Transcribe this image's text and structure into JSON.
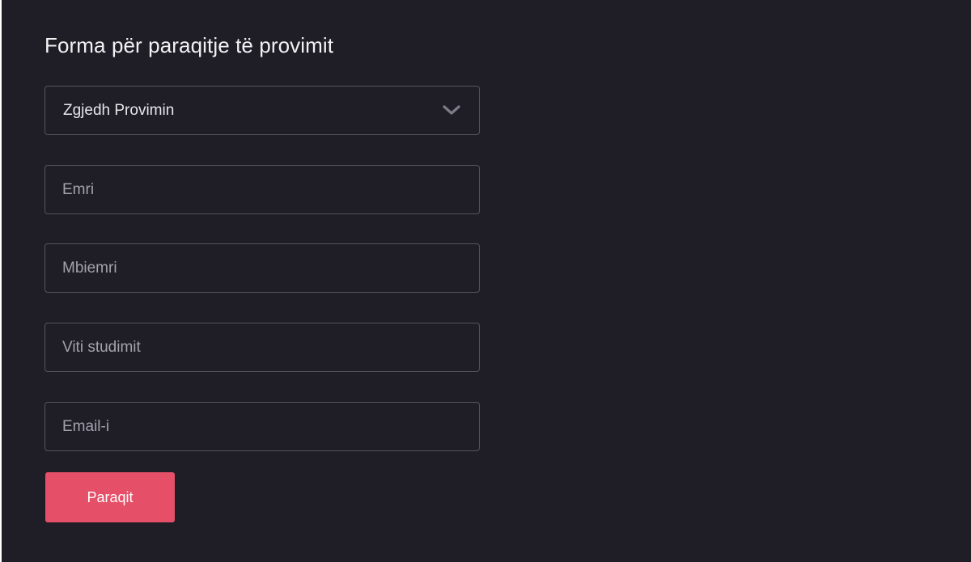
{
  "form": {
    "title": "Forma për paraqitje të provimit",
    "exam_select": {
      "selected_label": "Zgjedh Provimin",
      "icon": "chevron-down-icon"
    },
    "fields": {
      "name_placeholder": "Emri",
      "surname_placeholder": "Mbiemri",
      "study_year_placeholder": "Viti studimit",
      "email_placeholder": "Email-i"
    },
    "submit_label": "Paraqit"
  },
  "colors": {
    "background": "#1f1e27",
    "field_border": "#55545d",
    "placeholder_text": "#a3a2ab",
    "accent_button": "#e55068",
    "title_text": "#f2f2f4"
  }
}
